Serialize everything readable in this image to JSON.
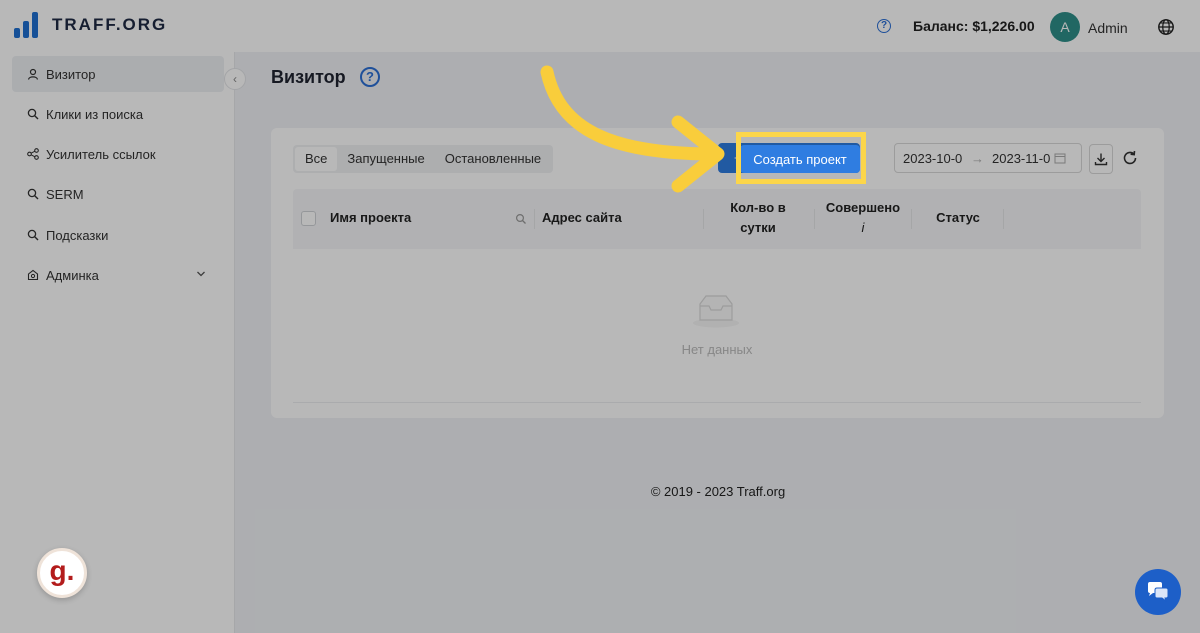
{
  "header": {
    "logo_text": "TRAFF.ORG",
    "help_icon": "?",
    "balance": "Баланс: $1,226.00",
    "avatar_letter": "A",
    "user_name": "Admin"
  },
  "sidebar": {
    "collapse_icon": "‹",
    "items": [
      {
        "label": "Визитор",
        "icon": "user-icon",
        "active": true
      },
      {
        "label": "Клики из поиска",
        "icon": "search-icon"
      },
      {
        "label": "Усилитель ссылок",
        "icon": "share-icon"
      },
      {
        "label": "SERM",
        "icon": "search-icon"
      },
      {
        "label": "Подсказки",
        "icon": "search-icon"
      },
      {
        "label": "Админка",
        "icon": "shield-icon"
      }
    ]
  },
  "main": {
    "title": "Визитор",
    "help_icon": "?",
    "filters": [
      "Все",
      "Запущенные",
      "Остановленные"
    ],
    "create_button": "Создать проект",
    "create_plus": "+",
    "date_from": "2023-10-0",
    "date_to": "2023-11-0",
    "date_arrow": "→",
    "table": {
      "headers": [
        "Имя проекта",
        "Адрес сайта",
        "Кол-во в",
        "сутки",
        "Совершено",
        "i",
        "Статус"
      ],
      "empty_text": "Нет данных"
    }
  },
  "footer": {
    "copyright": "© 2019 - 2023 Traff.org"
  },
  "widgets": {
    "g_badge": "g."
  },
  "colors": {
    "accent": "#2f7de1",
    "highlight": "#fcd64a",
    "logo": "#1f6fd1"
  }
}
